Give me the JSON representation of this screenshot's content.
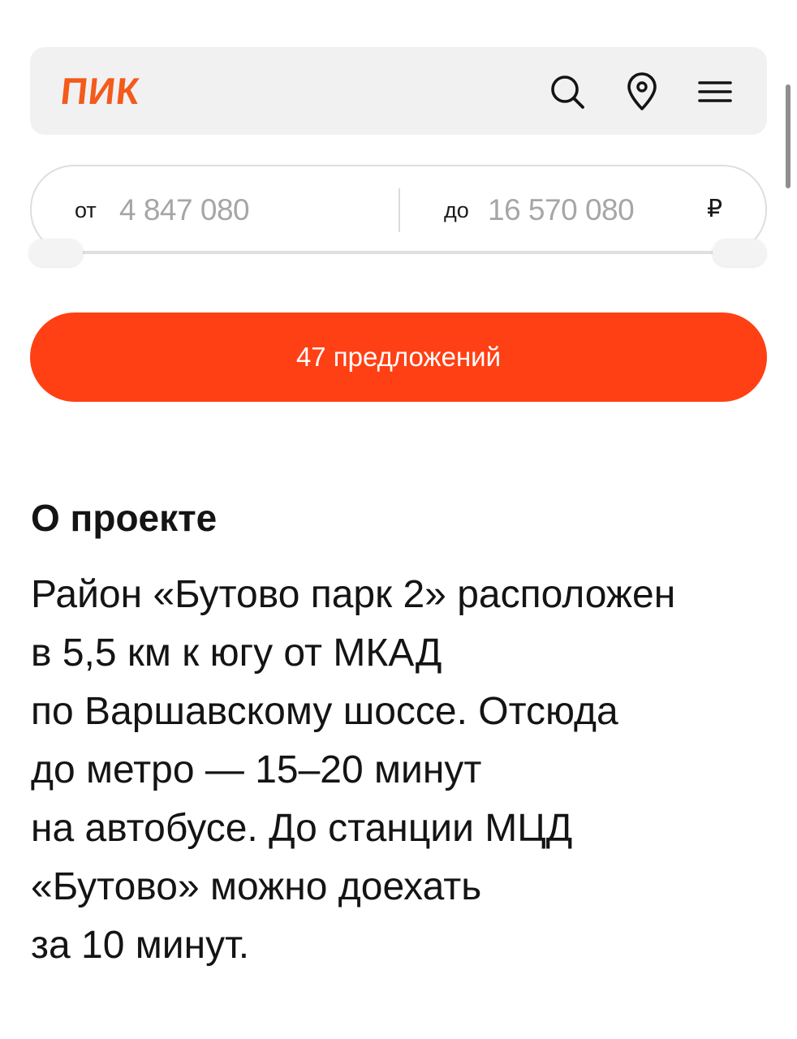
{
  "colors": {
    "accent": "#ff4015",
    "logo": "#f35a1c",
    "header_bg": "#f1f1f1",
    "muted_value": "#a6a6a6",
    "text": "#141414"
  },
  "header": {
    "logo_text": "ПИК",
    "icons": [
      "search-icon",
      "location-pin-icon",
      "menu-icon"
    ]
  },
  "price_filter": {
    "from_label": "от",
    "from_value": "4 847 080",
    "to_label": "до",
    "to_value": "16 570 080",
    "currency": "₽",
    "range_fraction": [
      0,
      1
    ]
  },
  "cta": {
    "label": "47 предложений"
  },
  "about": {
    "title": "О проекте",
    "lines": [
      "Район «Бутово парк 2» расположен",
      "в 5,5 км к югу от МКАД",
      "по Варшавскому шоссе. Отсюда",
      "до метро — 15–20 минут",
      "на автобусе. До станции МЦД",
      "«Бутово» можно доехать",
      "за 10 минут."
    ]
  }
}
